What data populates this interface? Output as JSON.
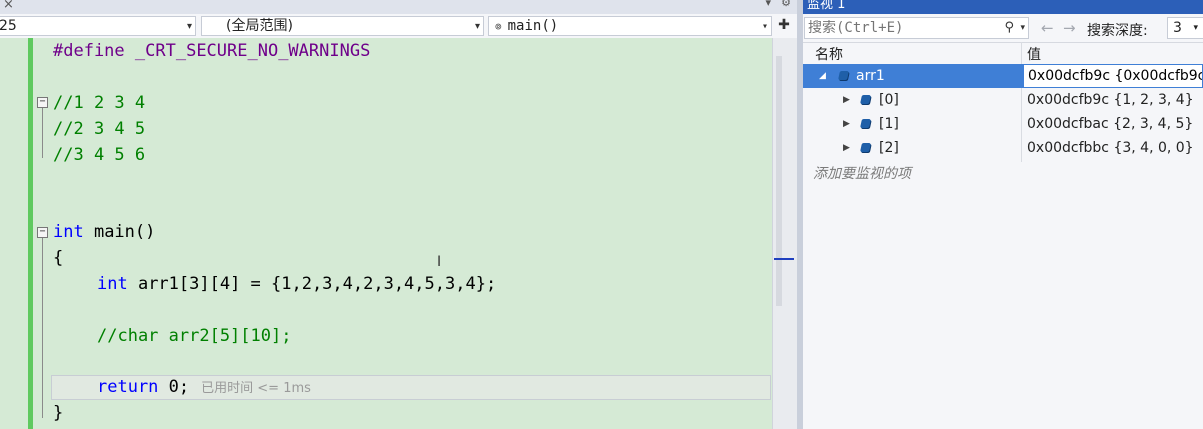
{
  "editor": {
    "nav": {
      "line_combo": "25",
      "scope_combo": "(全局范围)",
      "function_combo": "main()"
    },
    "lines": {
      "define_directive": "#define",
      "define_name": "_CRT_SECURE_NO_WARNINGS",
      "comment1": "//1 2 3 4",
      "comment2": "//2 3 4 5",
      "comment3": "//3 4 5 6",
      "int_kw": "int",
      "main_sig": " main()",
      "open_brace": "{",
      "int_kw2": "int",
      "arr_decl": " arr1[3][4] = {1,2,3,4,2,3,4,5,3,4};",
      "comment_char": "//char arr2[5][10];",
      "return_kw": "return",
      "return_rest": " 0;",
      "perf_tip": "已用时间 <= 1ms",
      "close_brace": "}"
    }
  },
  "watch": {
    "title": "监视 1",
    "search_placeholder": "搜索(Ctrl+E)",
    "depth_label": "搜索深度:",
    "depth_value": "3",
    "col_name": "名称",
    "col_value": "值",
    "rows": [
      {
        "name": "arr1",
        "value": "0x00dcfb9c {0x00dcfb9c"
      },
      {
        "name": "[0]",
        "value": "0x00dcfb9c {1, 2, 3, 4}"
      },
      {
        "name": "[1]",
        "value": "0x00dcfbac {2, 3, 4, 5}"
      },
      {
        "name": "[2]",
        "value": "0x00dcfbbc {3, 4, 0, 0}"
      }
    ],
    "add_item": "添加要监视的项"
  }
}
